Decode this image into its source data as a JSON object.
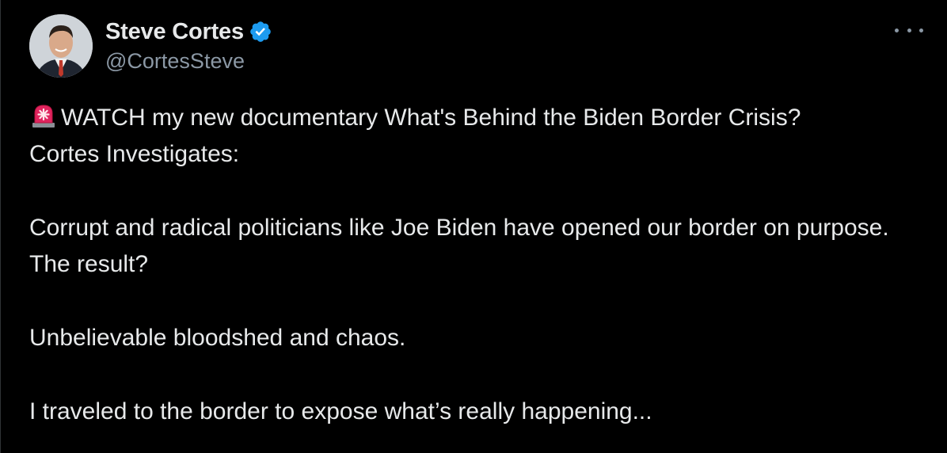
{
  "author": {
    "name": "Steve Cortes",
    "handle": "@CortesSteve"
  },
  "tweet": {
    "emoji": "siren-icon",
    "line1": "WATCH my new documentary What's Behind the Biden Border Crisis?",
    "line2": "Cortes Investigates:",
    "para2": "Corrupt and radical politicians like Joe Biden have opened our border on purpose. The result?",
    "para3": "Unbelievable bloodshed and chaos.",
    "para4": "I traveled to the border to expose what’s really happening..."
  },
  "colors": {
    "background": "#000000",
    "text": "#e7e9ea",
    "muted": "#8b98a5",
    "verified": "#1d9bf0"
  }
}
